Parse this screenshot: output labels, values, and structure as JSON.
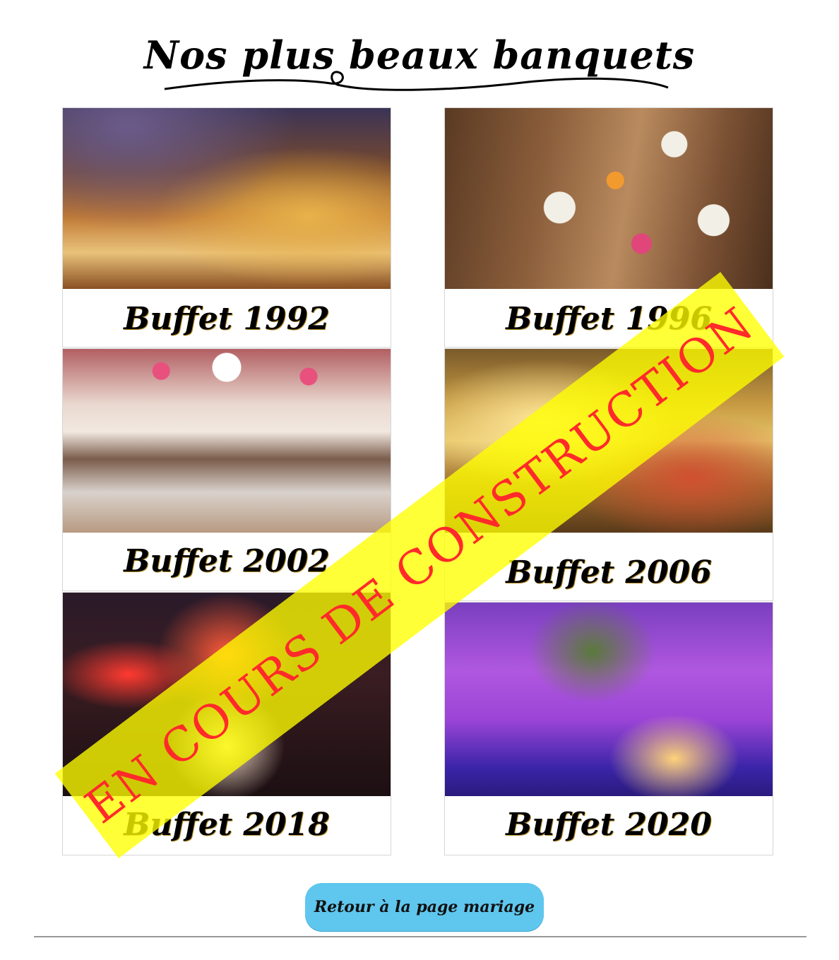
{
  "page_title": "Nos plus beaux banquets",
  "cards": [
    {
      "label": "Buffet 1992",
      "photo": "banquet-terrace-photo"
    },
    {
      "label": "Buffet 1996",
      "photo": "floral-table-photo"
    },
    {
      "label": "Buffet 2002",
      "photo": "white-ballroom-photo"
    },
    {
      "label": "Buffet 2006",
      "photo": "tropical-buffet-photo"
    },
    {
      "label": "Buffet 2018",
      "photo": "red-feather-gala-photo"
    },
    {
      "label": "Buffet 2020",
      "photo": "purple-reception-photo"
    }
  ],
  "construction_banner": "EN COURS DE CONSTRUCTION",
  "back_button": "Retour à la page mariage",
  "colors": {
    "banner_fill": "#ffff00",
    "banner_text": "#ff2a2a",
    "button_fill": "#5fc6ee",
    "divider": "#999999"
  }
}
